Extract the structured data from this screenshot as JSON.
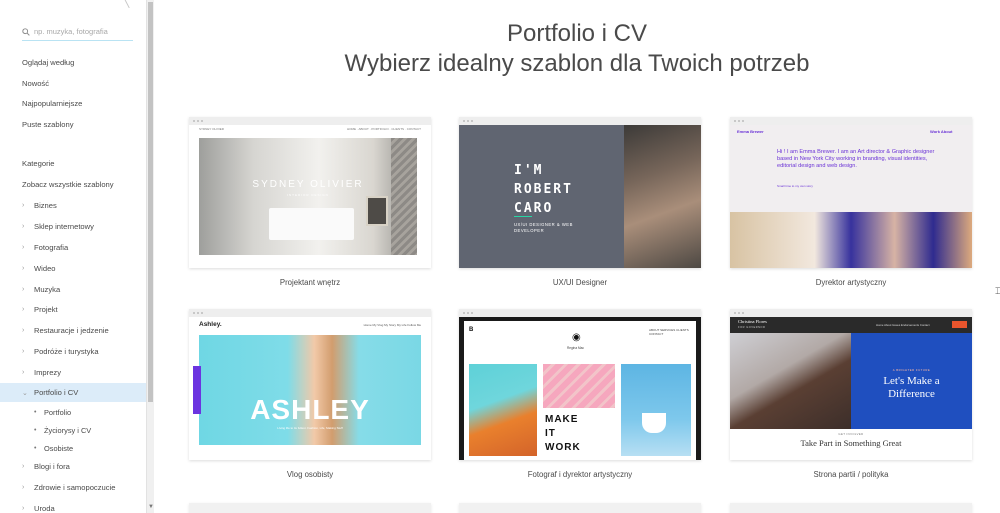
{
  "sidebar": {
    "search_placeholder": "np. muzyka, fotografia",
    "browse": [
      "Oglądaj według",
      "Nowość",
      "Najpopularniejsze",
      "Puste szablony"
    ],
    "categories_heading": "Kategorie",
    "all_templates": "Zobacz wszystkie szablony",
    "categories": [
      "Biznes",
      "Sklep internetowy",
      "Fotografia",
      "Wideo",
      "Muzyka",
      "Projekt",
      "Restauracje i jedzenie",
      "Podróże i turystyka",
      "Imprezy",
      "Portfolio i CV"
    ],
    "subcategories": [
      "Portfolio",
      "Życiorysy i CV",
      "Osobiste"
    ],
    "categories_after": [
      "Blogi i fora",
      "Zdrowie i samopoczucie",
      "Uroda"
    ],
    "active_category": "Portfolio i CV"
  },
  "page": {
    "title": "Portfolio i CV",
    "subtitle": "Wybierz idealny szablon dla Twoich potrzeb"
  },
  "templates": [
    {
      "label": "Projektant wnętrz",
      "preview": {
        "nav_left": "SYDNEY OLIVIER",
        "nav_right": "HOME · ABOUT · PORTFOLIO · CLIENTS · CONTACT",
        "name": "SYDNEY OLIVIER",
        "sub": "INTERIOR DESIGN"
      }
    },
    {
      "label": "UX/UI Designer",
      "preview": {
        "line1": "I'M",
        "line2": "ROBERT",
        "line3": "CARO",
        "tag1": "UX/UI DESIGNER & WEB",
        "tag2": "DEVELOPER"
      }
    },
    {
      "label": "Dyrektor artystyczny",
      "preview": {
        "logo": "Emma Brewer",
        "nav": "Work   About",
        "intro": "Hi ! I am Emma Brewer. I am an Art director & Graphic designer based in New York City working in branding, visual identities, editorial design and web design.",
        "small": "Small time to my own story"
      }
    },
    {
      "label": "Vlog osobisty",
      "preview": {
        "logo": "Ashley.",
        "links": "Home  My Vlog  My Story  My Life  Follow Me",
        "name": "ASHLEY",
        "tag": "Living life to its fullest. Fashion, Life, Making Stuff"
      }
    },
    {
      "label": "Fotograf i dyrektor artystyczny",
      "preview": {
        "b": "B",
        "links": "ABOUT  SERVICES  CLIENTS  CONTACT",
        "signature": "Regina Mac",
        "headline1": "MAKE",
        "headline2": "IT",
        "headline3": "WORK"
      }
    },
    {
      "label": "Strona partii / polityka",
      "preview": {
        "logo": "Christina Flores",
        "logo2": "FOR GOVERNOR",
        "links": "Home  About  Issues  Endorsements  Contact",
        "eyebrow": "A BRIGHTER FUTURE",
        "head1": "Let's Make a",
        "head2": "Difference",
        "section": "GET INVOLVED",
        "take": "Take Part in Something Great"
      }
    }
  ]
}
